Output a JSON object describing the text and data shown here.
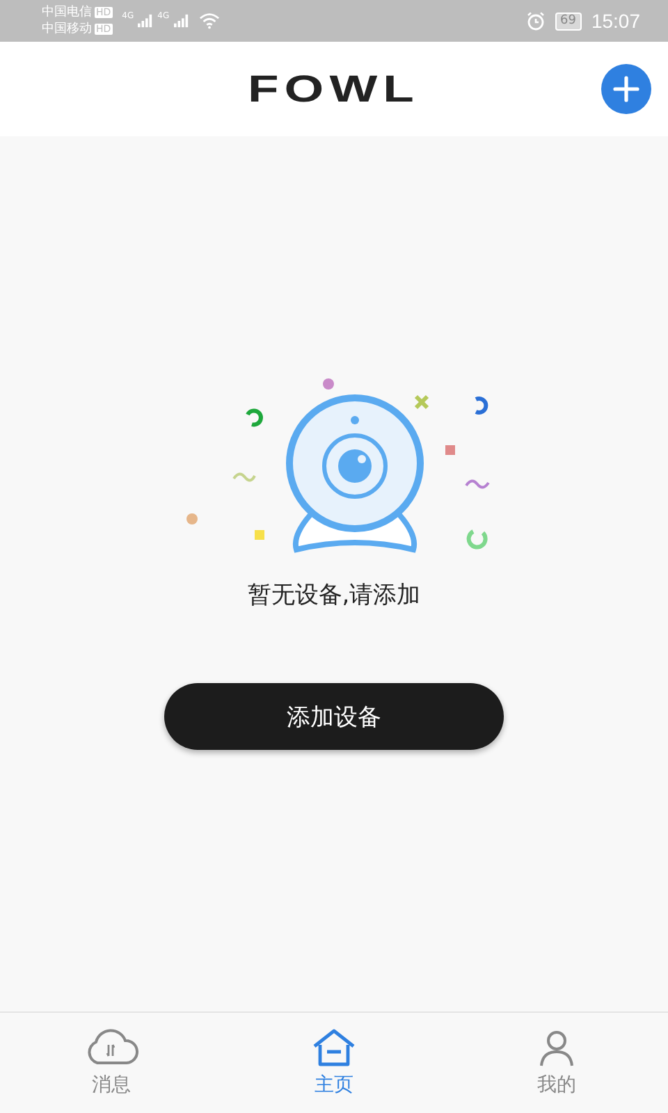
{
  "status_bar": {
    "carriers": [
      {
        "name": "中国电信",
        "badge": "HD",
        "network": "4G"
      },
      {
        "name": "中国移动",
        "badge": "HD",
        "network": "4G"
      }
    ],
    "battery": "69",
    "time": "15:07"
  },
  "header": {
    "logo": "FOWL"
  },
  "empty_state": {
    "message": "暂无设备,请添加",
    "button": "添加设备"
  },
  "tabs": [
    {
      "label": "消息",
      "kind": "cloud",
      "selected": false
    },
    {
      "label": "主页",
      "kind": "home",
      "selected": true
    },
    {
      "label": "我的",
      "kind": "person",
      "selected": false
    }
  ]
}
